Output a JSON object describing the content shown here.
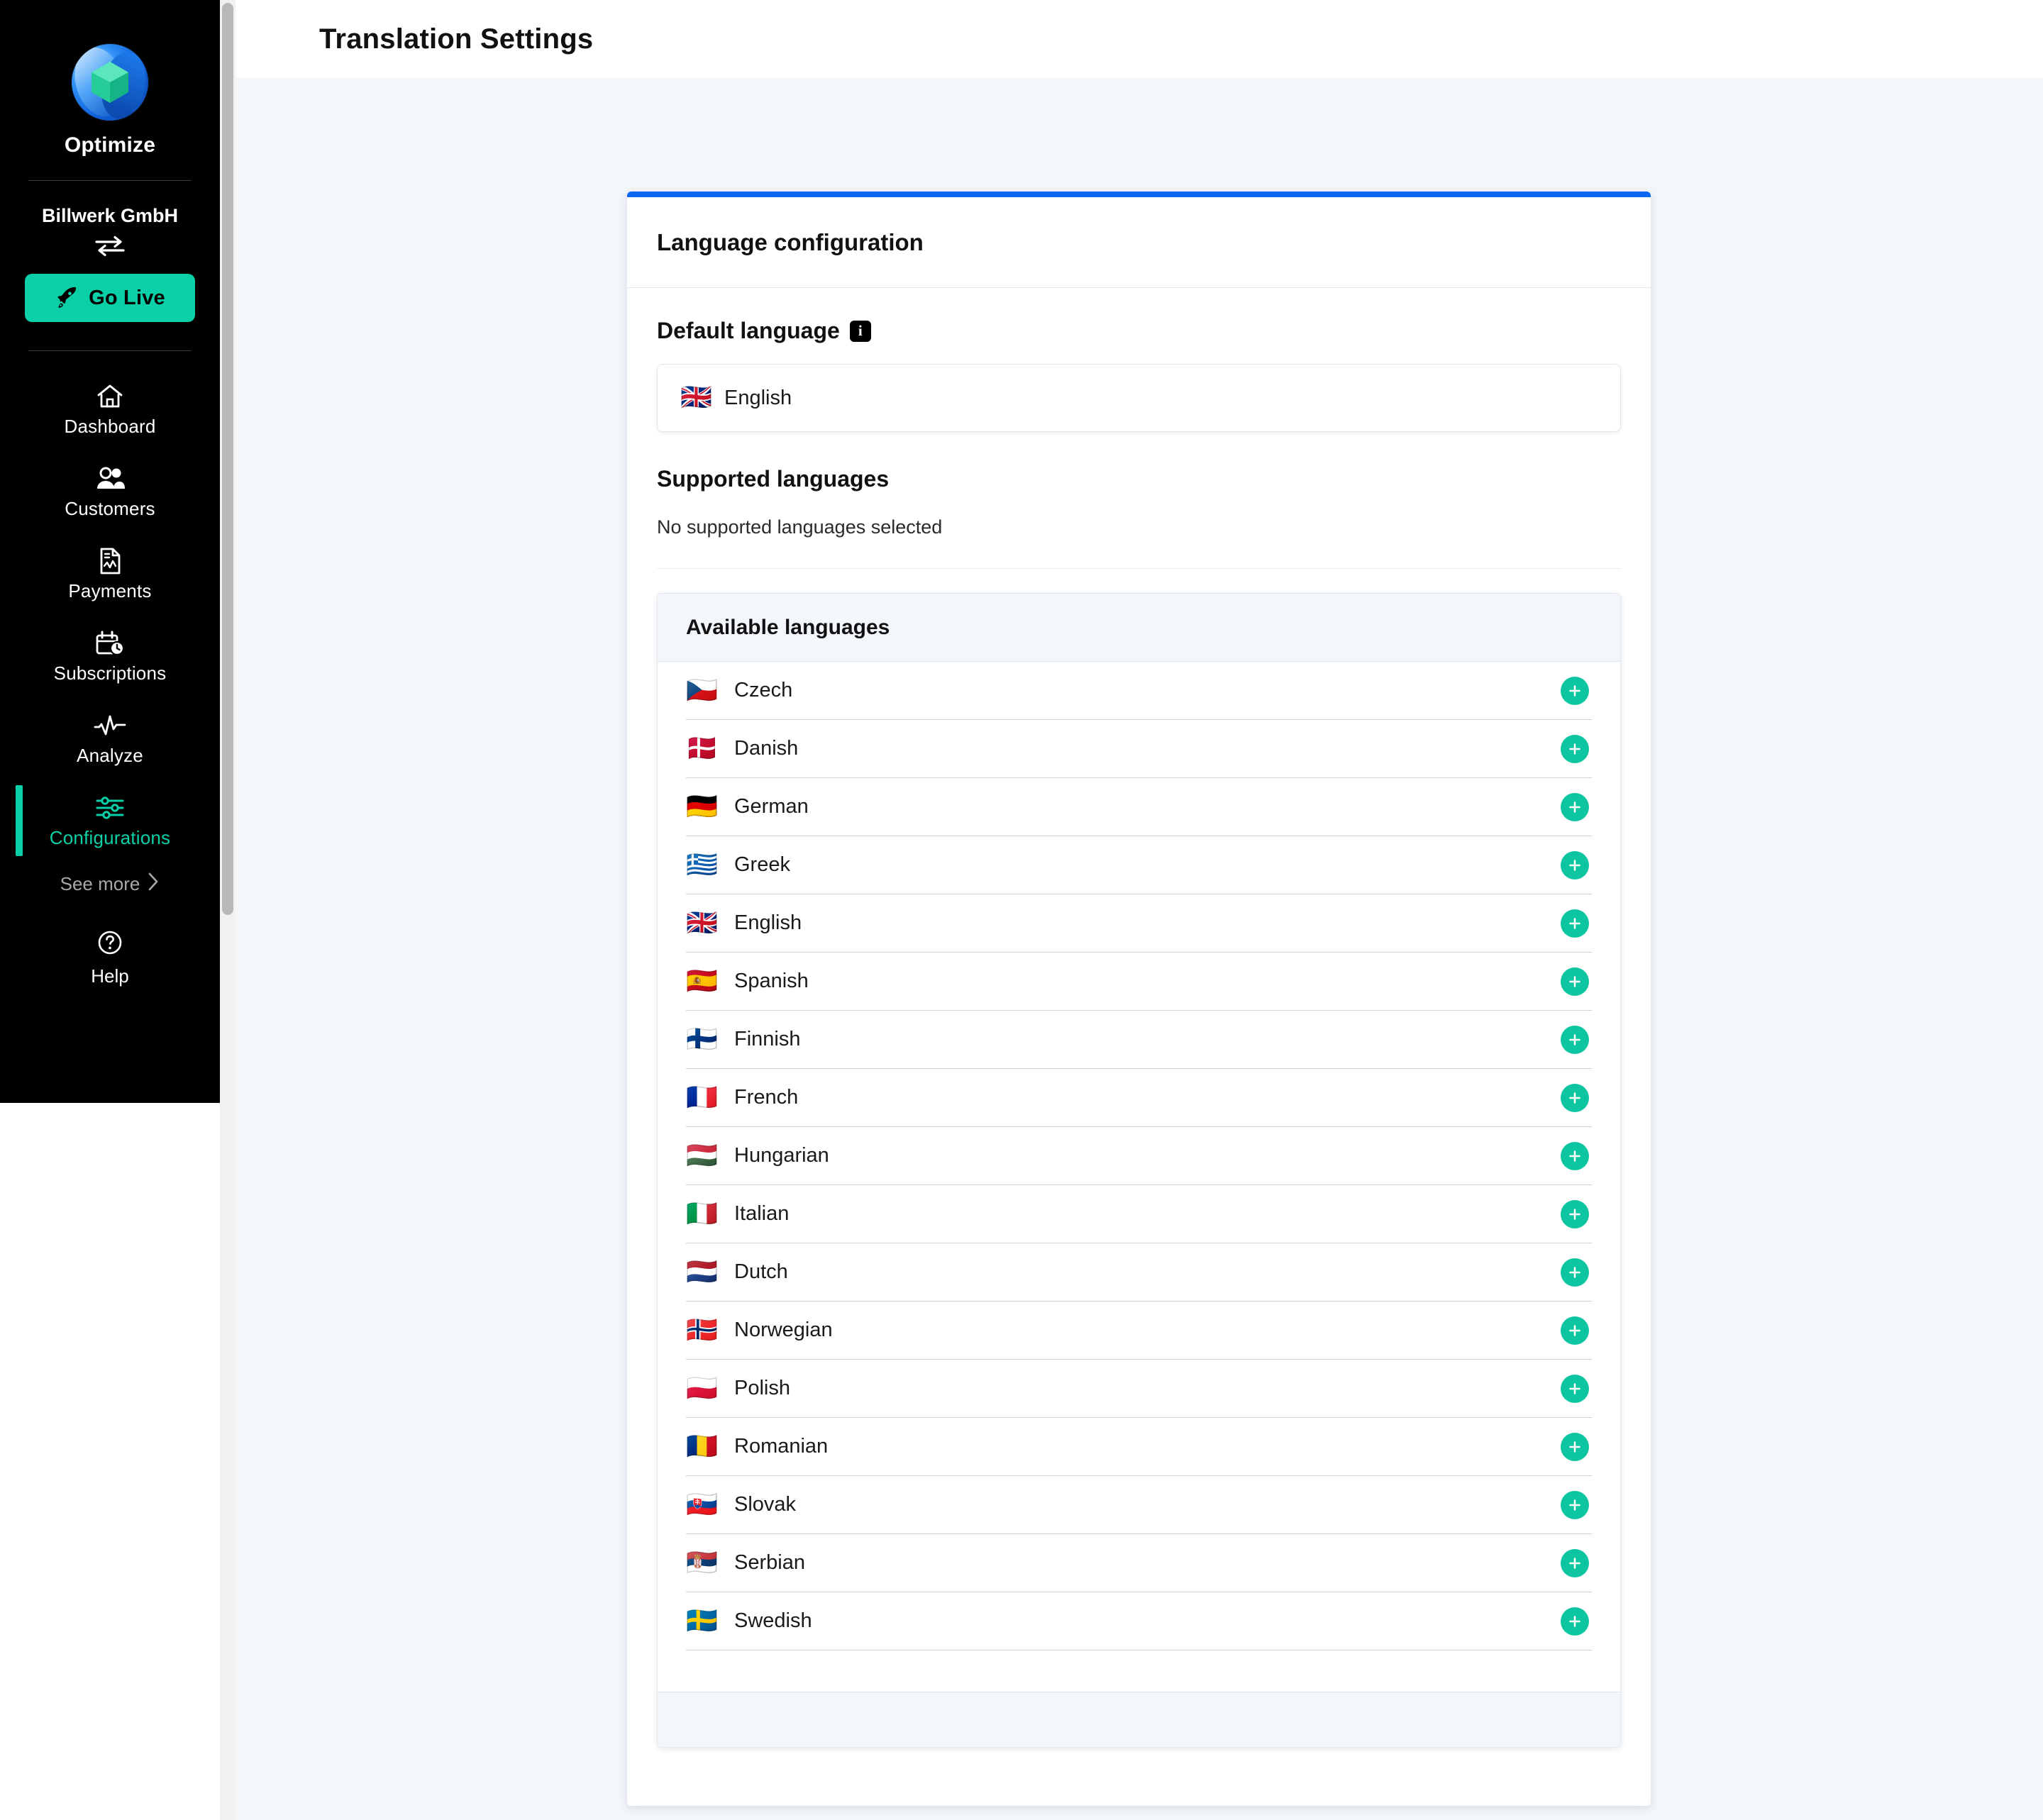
{
  "sidebar": {
    "logo_icon": "optimize-logo-icon",
    "brand_name": "Optimize",
    "org_name": "Billwerk GmbH",
    "switch_icon": "switch-arrows-icon",
    "go_live": {
      "label": "Go Live",
      "icon": "rocket-icon",
      "color": "#0ad0a8"
    },
    "nav_items": [
      {
        "label": "Dashboard",
        "icon": "home-icon",
        "active": false
      },
      {
        "label": "Customers",
        "icon": "users-icon",
        "active": false
      },
      {
        "label": "Payments",
        "icon": "document-icon",
        "active": false
      },
      {
        "label": "Subscriptions",
        "icon": "calendar-clock-icon",
        "active": false
      },
      {
        "label": "Analyze",
        "icon": "pulse-icon",
        "active": false
      },
      {
        "label": "Configurations",
        "icon": "sliders-icon",
        "active": true
      }
    ],
    "see_more": {
      "label": "See more",
      "icon": "chevron-right-icon"
    },
    "help": {
      "label": "Help",
      "icon": "question-circle-icon"
    }
  },
  "header": {
    "title": "Translation Settings"
  },
  "card": {
    "accent_color": "#0a66f5",
    "title": "Language configuration",
    "default_language": {
      "label": "Default language",
      "info_icon": "info-icon",
      "info_glyph": "i",
      "selected": {
        "name": "English",
        "flag": "🇬🇧"
      }
    },
    "supported_languages": {
      "label": "Supported languages",
      "empty_text": "No supported languages selected"
    },
    "available_languages": {
      "title": "Available languages",
      "add_icon": "plus-icon",
      "add_color": "#0dc5a0",
      "items": [
        {
          "name": "Czech",
          "flag": "🇨🇿"
        },
        {
          "name": "Danish",
          "flag": "🇩🇰"
        },
        {
          "name": "German",
          "flag": "🇩🇪"
        },
        {
          "name": "Greek",
          "flag": "🇬🇷"
        },
        {
          "name": "English",
          "flag": "🇬🇧"
        },
        {
          "name": "Spanish",
          "flag": "🇪🇸"
        },
        {
          "name": "Finnish",
          "flag": "🇫🇮"
        },
        {
          "name": "French",
          "flag": "🇫🇷"
        },
        {
          "name": "Hungarian",
          "flag": "🇭🇺"
        },
        {
          "name": "Italian",
          "flag": "🇮🇹"
        },
        {
          "name": "Dutch",
          "flag": "🇳🇱"
        },
        {
          "name": "Norwegian",
          "flag": "🇳🇴"
        },
        {
          "name": "Polish",
          "flag": "🇵🇱"
        },
        {
          "name": "Romanian",
          "flag": "🇷🇴"
        },
        {
          "name": "Slovak",
          "flag": "🇸🇰"
        },
        {
          "name": "Serbian",
          "flag": "🇷🇸"
        },
        {
          "name": "Swedish",
          "flag": "🇸🇪"
        }
      ]
    }
  }
}
